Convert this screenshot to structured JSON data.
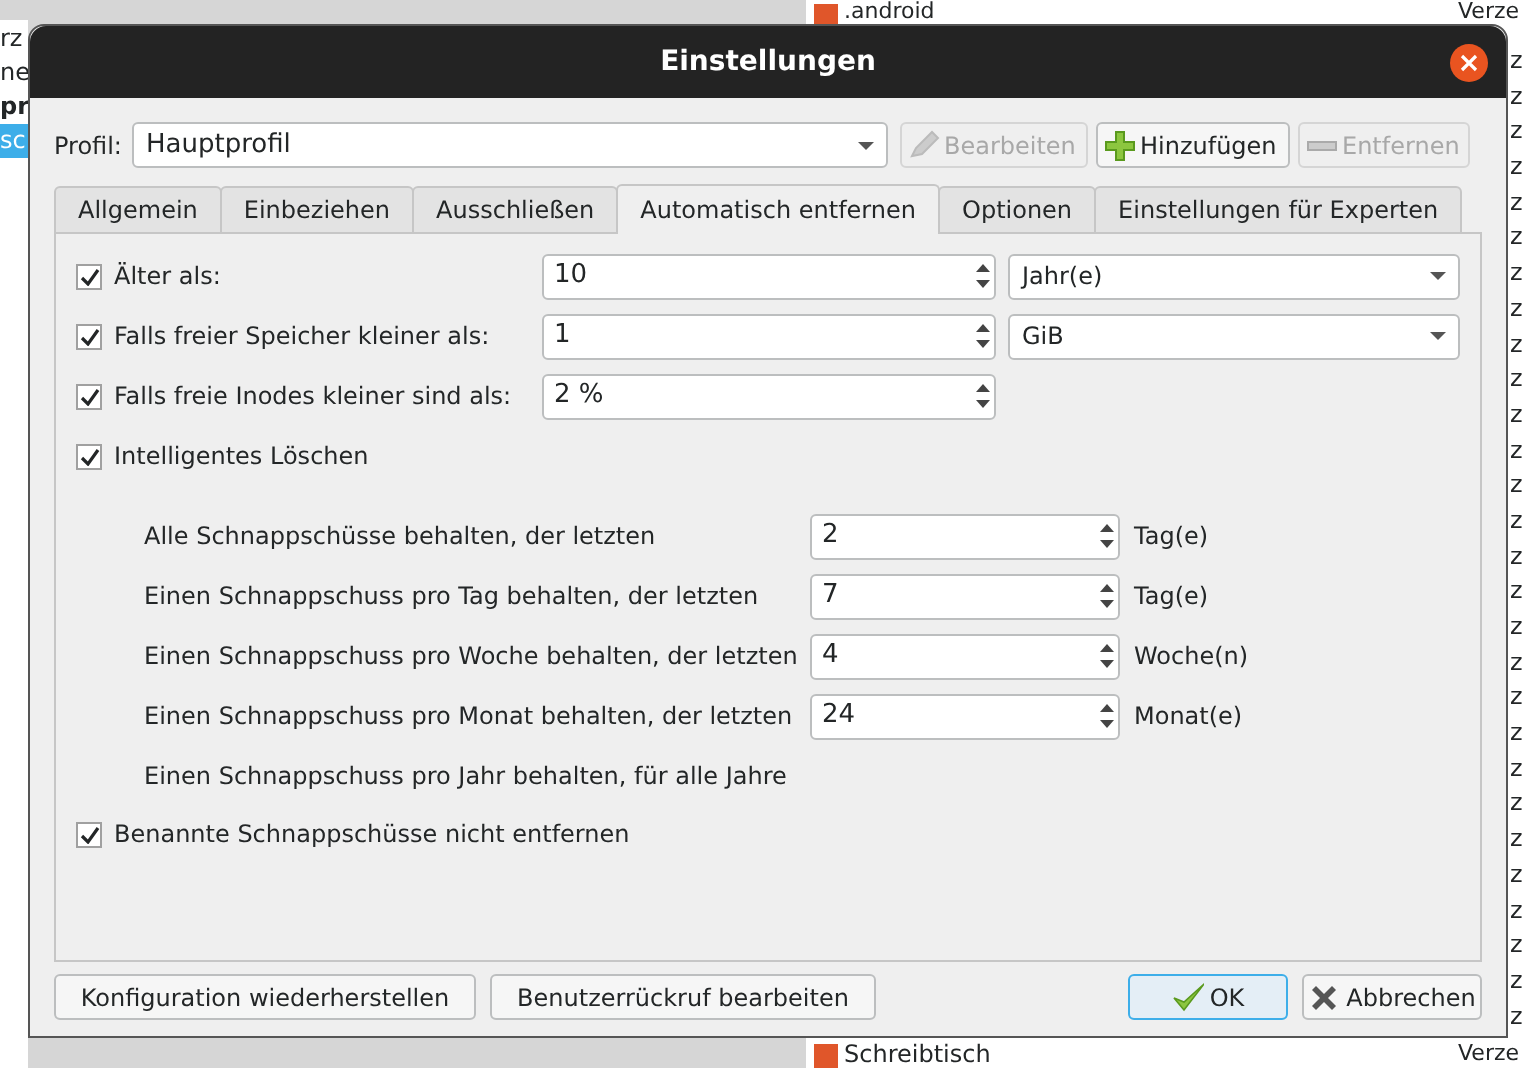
{
  "background": {
    "top_item": {
      "name": ".android",
      "type": "Verze"
    },
    "left_items": [
      {
        "text": "rz",
        "bold": false,
        "selected": false
      },
      {
        "text": "ne",
        "bold": false,
        "selected": false
      },
      {
        "text": "pr",
        "bold": true,
        "selected": false
      },
      {
        "text": "sc",
        "bold": false,
        "selected": true
      }
    ],
    "right_column": [
      "z",
      "z",
      "z",
      "z",
      "z",
      "z",
      "z",
      "z",
      "z",
      "z",
      "z",
      "z",
      "z",
      "z",
      "z",
      "z",
      "z",
      "z",
      "z",
      "z",
      "z",
      "z",
      "z",
      "z",
      "z",
      "z",
      "z",
      "z"
    ],
    "bottom_item": {
      "name": "Schreibtisch",
      "type": "Verze"
    }
  },
  "window": {
    "title": "Einstellungen"
  },
  "profile": {
    "label": "Profil:",
    "value": "Hauptprofil"
  },
  "profile_buttons": [
    {
      "label": "Bearbeiten",
      "kind": "edit",
      "disabled": true
    },
    {
      "label": "Hinzufügen",
      "kind": "add",
      "disabled": false
    },
    {
      "label": "Entfernen",
      "kind": "remove",
      "disabled": true
    }
  ],
  "tabs": [
    {
      "label": "Allgemein",
      "selected": false
    },
    {
      "label": "Einbeziehen",
      "selected": false
    },
    {
      "label": "Ausschließen",
      "selected": false
    },
    {
      "label": "Automatisch entfernen",
      "selected": true
    },
    {
      "label": "Optionen",
      "selected": false
    },
    {
      "label": "Einstellungen für Experten",
      "selected": false
    }
  ],
  "rules": [
    {
      "kind": "spin_combo",
      "label": "Älter als:",
      "checked": true,
      "value": "10",
      "unit": "Jahr(e)"
    },
    {
      "kind": "spin_combo",
      "label": "Falls freier Speicher kleiner als:",
      "checked": true,
      "value": "1",
      "unit": "GiB"
    },
    {
      "kind": "spin",
      "label": "Falls freie Inodes kleiner sind als:",
      "checked": true,
      "value": "2 %"
    },
    {
      "kind": "plain",
      "label": "Intelligentes Löschen",
      "checked": true
    }
  ],
  "smart": [
    {
      "label": "Alle Schnappschüsse behalten, der letzten",
      "value": "2",
      "unit": "Tag(e)"
    },
    {
      "label": "Einen Schnappschuss pro Tag behalten, der letzten",
      "value": "7",
      "unit": "Tag(e)"
    },
    {
      "label": "Einen Schnappschuss pro Woche behalten, der letzten",
      "value": "4",
      "unit": "Woche(n)"
    },
    {
      "label": "Einen Schnappschuss pro Monat behalten, der letzten",
      "value": "24",
      "unit": "Monat(e)"
    },
    {
      "label": "Einen Schnappschuss pro Jahr behalten, für alle Jahre"
    }
  ],
  "keep_named": {
    "label": "Benannte Schnappschüsse nicht entfernen",
    "checked": true
  },
  "footer_buttons": [
    "Konfiguration wiederherstellen",
    "Benutzerrückruf bearbeiten"
  ],
  "dialog_buttons": [
    {
      "label": "OK",
      "kind": "ok",
      "default": true
    },
    {
      "label": "Abbrechen",
      "kind": "cancel",
      "default": false
    }
  ]
}
